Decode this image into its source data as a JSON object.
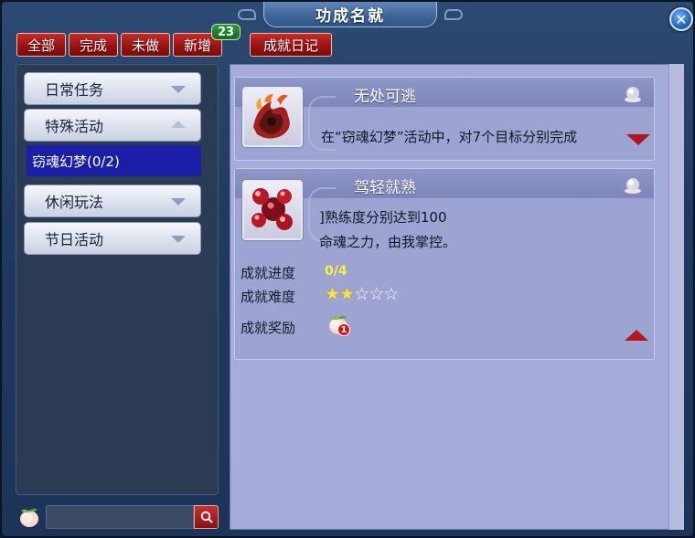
{
  "window": {
    "title": "功成名就"
  },
  "filter_tabs": [
    {
      "label": "全部"
    },
    {
      "label": "完成"
    },
    {
      "label": "未做"
    },
    {
      "label": "新增",
      "badge": "23"
    },
    {
      "label": "成就日记"
    }
  ],
  "categories": [
    {
      "label": "日常任务",
      "expanded": false
    },
    {
      "label": "特殊活动",
      "expanded": true,
      "children": [
        {
          "label": "窃魂幻梦(0/2)",
          "selected": true
        }
      ]
    },
    {
      "label": "休闲玩法",
      "expanded": false
    },
    {
      "label": "节日活动",
      "expanded": false
    }
  ],
  "search": {
    "placeholder": "",
    "icon": "search-icon"
  },
  "achievements": [
    {
      "title": "无处可逃",
      "description": "在“窃魂幻梦”活动中，对7个目标分别完成",
      "icon": "red-flame-claw",
      "expanded": false
    },
    {
      "title": "驾轻就熟",
      "description_lines": [
        "]熟练度分别达到100",
        "命魂之力，由我掌控。"
      ],
      "icon": "red-orbs",
      "expanded": true,
      "progress_label": "成就进度",
      "progress_value": "0/4",
      "difficulty_label": "成就难度",
      "difficulty_stars": 2,
      "difficulty_max": 5,
      "reward_label": "成就奖励",
      "reward_item": "peach",
      "reward_count": "1"
    }
  ],
  "colors": {
    "tab_red": "#9a1313",
    "selected_blue": "#1b1fa8",
    "panel_lavender": "#a6acd9",
    "progress_yellow": "#f7f33a",
    "arrow_red": "#b0171f"
  }
}
